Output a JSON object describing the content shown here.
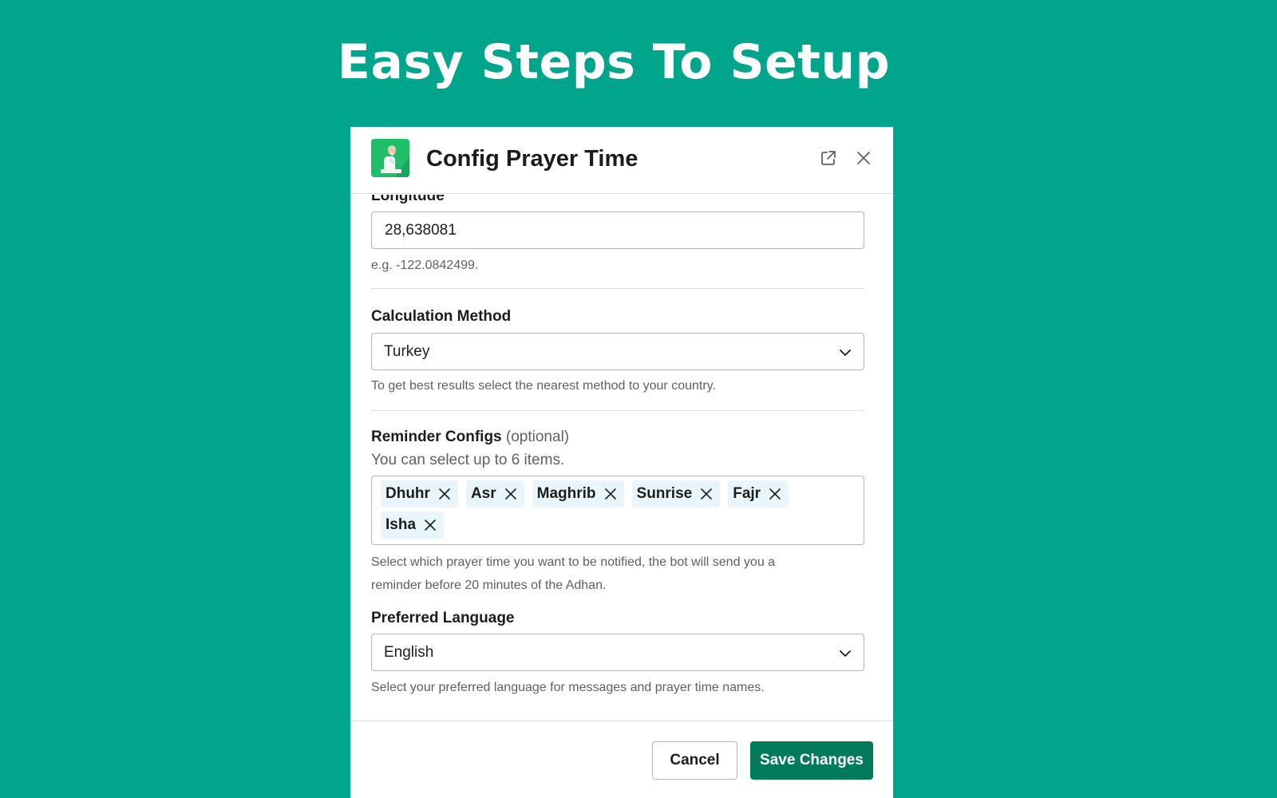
{
  "page": {
    "heading": "Easy Steps To Setup"
  },
  "modal": {
    "title": "Config Prayer Time",
    "app_icon": "praying-person-icon",
    "external_icon": "open-external-icon",
    "close_icon": "close-icon"
  },
  "fields": {
    "longitude": {
      "label": "Longitude",
      "value": "28,638081",
      "hint": "e.g. -122.0842499."
    },
    "calculation_method": {
      "label": "Calculation Method",
      "selected": "Turkey",
      "hint": "To get best results select the nearest method to your country."
    },
    "reminder_configs": {
      "label": "Reminder Configs",
      "optional": "(optional)",
      "sub_hint": "You can select up to 6 items.",
      "selected_items": [
        {
          "label": "Dhuhr"
        },
        {
          "label": "Asr"
        },
        {
          "label": "Maghrib"
        },
        {
          "label": "Sunrise"
        },
        {
          "label": "Fajr"
        },
        {
          "label": "Isha"
        }
      ],
      "hint": "Select which prayer time you want to be notified, the bot will send you a reminder before 20 minutes of the Adhan."
    },
    "preferred_language": {
      "label": "Preferred Language",
      "selected": "English",
      "hint": "Select your preferred language for messages and prayer time names."
    }
  },
  "footer": {
    "cancel_label": "Cancel",
    "save_label": "Save Changes"
  },
  "colors": {
    "background": "#00a58c",
    "primary_button": "#007a5a",
    "chip_background": "#e8f5fa",
    "app_icon_green": "#1fbf6a"
  }
}
